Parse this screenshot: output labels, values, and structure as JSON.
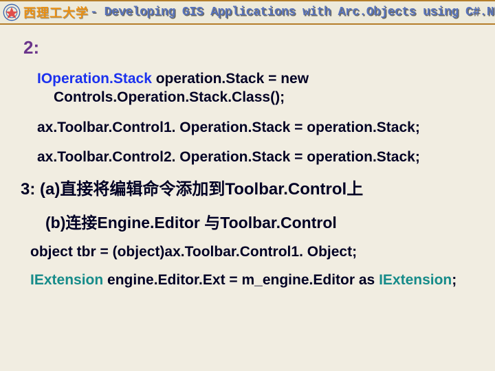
{
  "header": {
    "uni_name": "西理工大学",
    "tagline": " - Developing GIS Applications with Arc.Objects using C#.NE"
  },
  "section2": {
    "label": "2:",
    "code1a": "IOperation.Stack",
    "code1b": " operation.Stack = new Controls.Operation.Stack.Class();",
    "code2": "ax.Toolbar.Control1. Operation.Stack = operation.Stack;",
    "code3": "ax.Toolbar.Control2. Operation.Stack = operation.Stack;"
  },
  "section3": {
    "line_a": "3: (a)直接将编辑命令添加到Toolbar.Control上",
    "line_b": "(b)连接Engine.Editor 与Toolbar.Control",
    "code1": "object tbr = (object)ax.Toolbar.Control1. Object;",
    "code2a": "IExtension",
    "code2b": " engine.Editor.Ext = m_engine.Editor as ",
    "code2c": "IExtension",
    "code2d": ";"
  }
}
